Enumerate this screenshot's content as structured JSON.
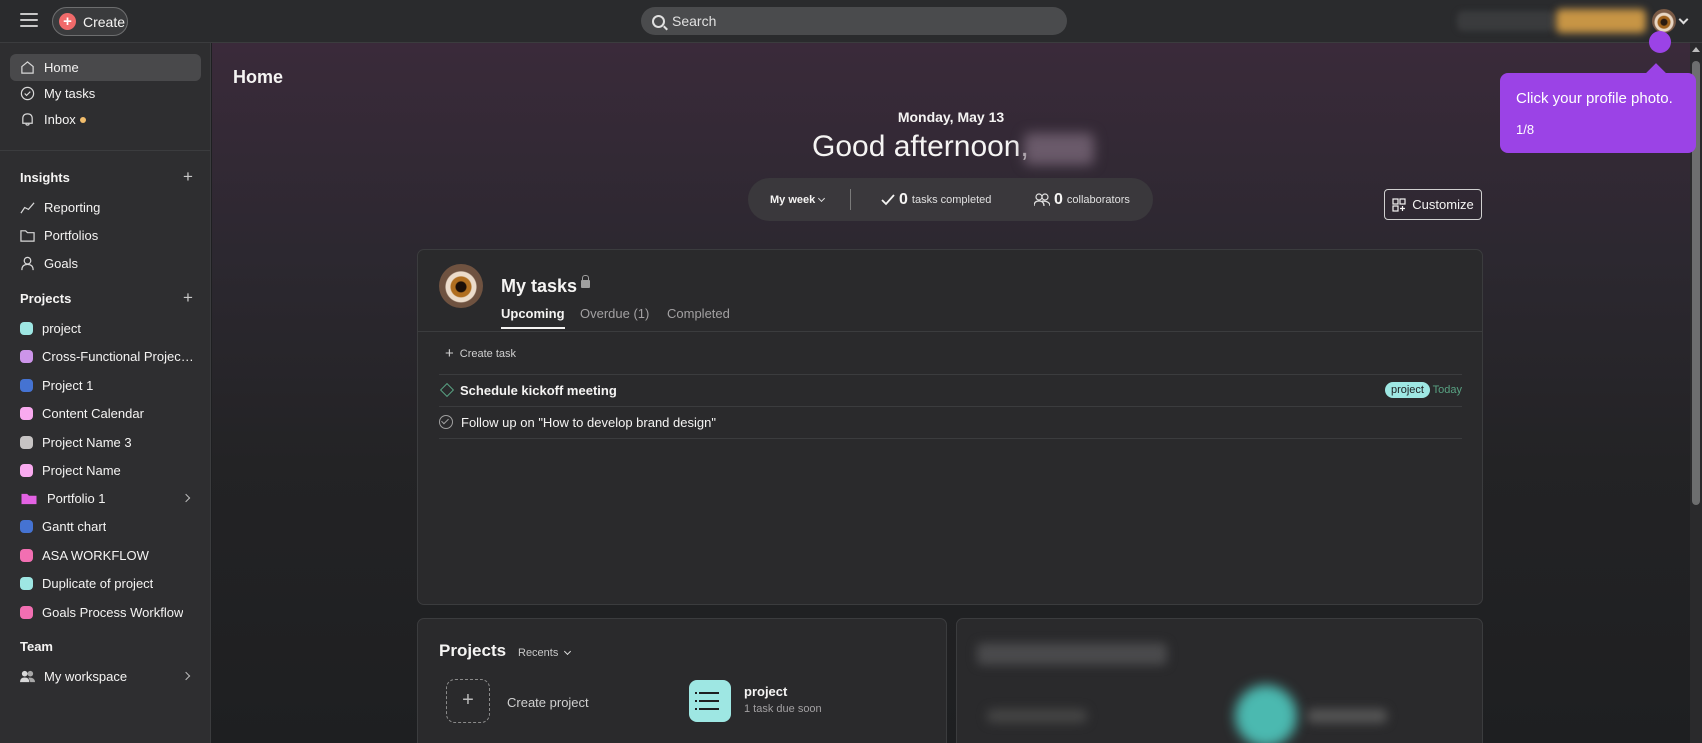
{
  "topbar": {
    "create_label": "Create",
    "search_placeholder": "Search"
  },
  "sidebar": {
    "nav": [
      {
        "label": "Home",
        "icon": "home-icon"
      },
      {
        "label": "My tasks",
        "icon": "check-circle-icon"
      },
      {
        "label": "Inbox",
        "icon": "bell-icon"
      }
    ],
    "insights_title": "Insights",
    "insights": [
      {
        "label": "Reporting",
        "icon": "chart-line-icon"
      },
      {
        "label": "Portfolios",
        "icon": "folder-icon"
      },
      {
        "label": "Goals",
        "icon": "person-icon"
      }
    ],
    "projects_title": "Projects",
    "projects": [
      {
        "label": "project",
        "color": "#9ee7e3"
      },
      {
        "label": "Cross-Functional Project Plan",
        "color": "#cd95ea"
      },
      {
        "label": "Project 1",
        "color": "#4573d2"
      },
      {
        "label": "Content Calendar",
        "color": "#f9aaef"
      },
      {
        "label": "Project Name 3",
        "color": "#c7c4c4"
      },
      {
        "label": "Project Name",
        "color": "#f9aaef"
      },
      {
        "label": "Portfolio 1",
        "color": "#e362e3"
      },
      {
        "label": "Gantt chart",
        "color": "#4573d2"
      },
      {
        "label": "ASA WORKFLOW",
        "color": "#f26fb2"
      },
      {
        "label": "Duplicate of project",
        "color": "#9ee7e3"
      },
      {
        "label": "Goals Process Workflow",
        "color": "#f26fb2"
      }
    ],
    "team_title": "Team",
    "team_item": "My workspace"
  },
  "main": {
    "page_title": "Home",
    "date": "Monday, May 13",
    "greeting": "Good afternoon,",
    "my_week": "My week",
    "tasks_completed_count": "0",
    "tasks_completed_label": "tasks completed",
    "collaborators_count": "0",
    "collaborators_label": "collaborators",
    "customize_label": "Customize"
  },
  "my_tasks": {
    "title": "My tasks",
    "tabs": [
      "Upcoming",
      "Overdue (1)",
      "Completed"
    ],
    "create_task": "Create task",
    "tasks": [
      {
        "name": "Schedule kickoff meeting",
        "tag": "project",
        "due": "Today"
      },
      {
        "name": "Follow up on \"How to develop brand design\""
      }
    ]
  },
  "projects_widget": {
    "title": "Projects",
    "filter": "Recents",
    "create_label": "Create project",
    "project_name": "project",
    "project_sub": "1 task due soon"
  },
  "tooltip": {
    "text": "Click your profile photo.",
    "step": "1/8",
    "color": "#9b43e6"
  }
}
